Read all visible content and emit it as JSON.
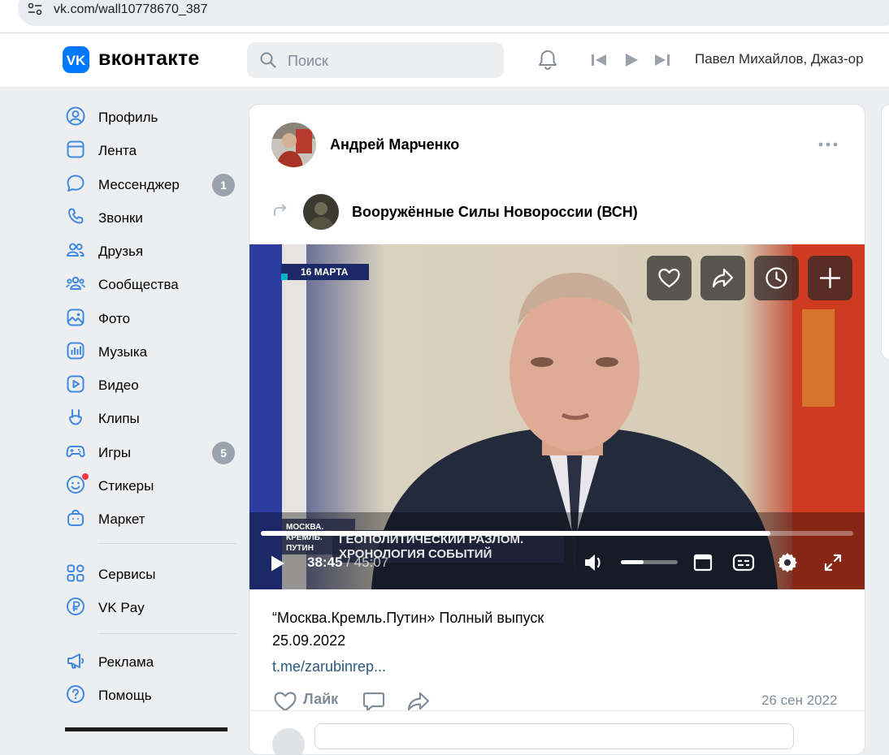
{
  "browser": {
    "url": "vk.com/wall10778670_387"
  },
  "header": {
    "logo_text": "вконтакте",
    "search_placeholder": "Поиск",
    "now_playing": "Павел Михайлов, Джаз-ор",
    "brand_color": "#0077ff"
  },
  "sidebar": {
    "items": [
      {
        "label": "Профиль",
        "icon": "user-circle-icon"
      },
      {
        "label": "Лента",
        "icon": "news-feed-icon"
      },
      {
        "label": "Мессенджер",
        "icon": "message-bubble-icon",
        "badge": "1"
      },
      {
        "label": "Звонки",
        "icon": "phone-icon"
      },
      {
        "label": "Друзья",
        "icon": "friends-icon"
      },
      {
        "label": "Сообщества",
        "icon": "communities-icon"
      },
      {
        "label": "Фото",
        "icon": "photo-icon"
      },
      {
        "label": "Музыка",
        "icon": "music-icon"
      },
      {
        "label": "Видео",
        "icon": "video-icon"
      },
      {
        "label": "Клипы",
        "icon": "clips-icon"
      },
      {
        "label": "Игры",
        "icon": "gamepad-icon",
        "badge": "5"
      },
      {
        "label": "Стикеры",
        "icon": "sticker-smile-icon"
      },
      {
        "label": "Маркет",
        "icon": "market-bag-icon"
      },
      {
        "label": "Сервисы",
        "icon": "services-grid-icon"
      },
      {
        "label": "VK Pay",
        "icon": "vkpay-ruble-icon"
      },
      {
        "label": "Реклама",
        "icon": "megaphone-icon"
      },
      {
        "label": "Помощь",
        "icon": "help-question-icon"
      }
    ]
  },
  "post": {
    "author": "Андрей Марченко",
    "repost_source": "Вооружённые Силы Новороссии (ВСН)",
    "video": {
      "date_tag": "16 МАРТА",
      "chyron_small": "МОСКВА.\nКРЕМЛЬ.\nПУТИН",
      "chyron_big": "ГЕОПОЛИТИЧЕСКИЙ РАЗЛОМ.\nХРОНОЛОГИЯ СОБЫТИЙ",
      "current_time": "38:45",
      "duration": "/ 45:07",
      "progress": 0.86,
      "volume": 0.4
    },
    "text": "“Москва.Кремль.Путин» Полный выпуск\n25.09.2022",
    "link": "t.me/zarubinrep...",
    "like_label": "Лайк",
    "date": "26 сен 2022",
    "link_color": "#2a5885"
  }
}
